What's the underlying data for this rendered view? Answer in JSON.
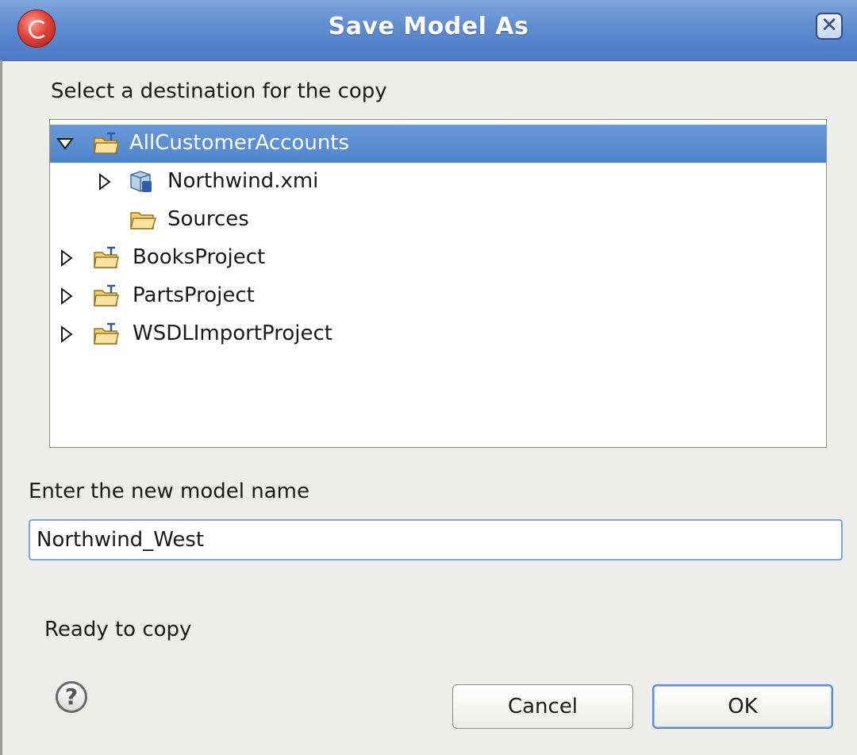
{
  "window": {
    "title": "Save Model As",
    "app_icon": "redhat-shadowman-icon",
    "close_icon": "close-icon",
    "close_glyph": "✕"
  },
  "destination": {
    "prompt": "Select a destination for the copy",
    "tree": [
      {
        "label": "AllCustomerAccounts",
        "icon": "project-folder-icon",
        "expanded": true,
        "selected": true,
        "level": 0
      },
      {
        "label": "Northwind.xmi",
        "icon": "model-icon",
        "expanded": false,
        "selected": false,
        "level": 1
      },
      {
        "label": "Sources",
        "icon": "folder-icon",
        "expanded": null,
        "selected": false,
        "level": 1
      },
      {
        "label": "BooksProject",
        "icon": "project-folder-icon",
        "expanded": false,
        "selected": false,
        "level": 0
      },
      {
        "label": "PartsProject",
        "icon": "project-folder-icon",
        "expanded": false,
        "selected": false,
        "level": 0
      },
      {
        "label": "WSDLImportProject",
        "icon": "project-folder-icon",
        "expanded": false,
        "selected": false,
        "level": 0
      }
    ]
  },
  "model_name": {
    "prompt": "Enter the new model name",
    "value": "Northwind_West"
  },
  "status": {
    "message": "Ready to copy"
  },
  "buttons": {
    "help_icon": "help-icon",
    "help_glyph": "?",
    "cancel_label": "Cancel",
    "ok_label": "OK"
  },
  "colors": {
    "titlebar": "#5f8bd0",
    "selection": "#4f83cb",
    "dialog_bg": "#ededeb"
  }
}
